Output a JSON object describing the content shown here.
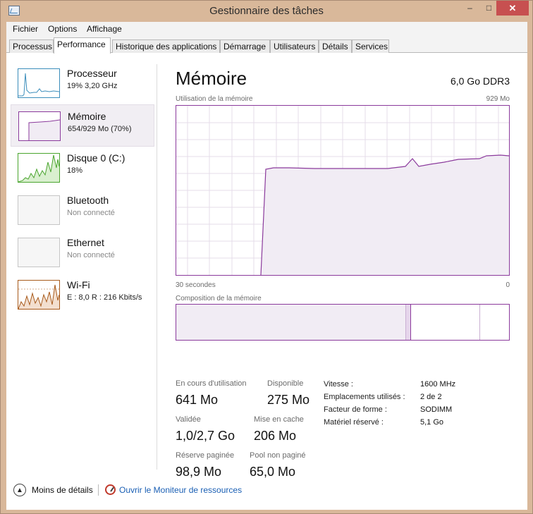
{
  "window": {
    "title": "Gestionnaire des tâches",
    "min": "–",
    "max": "□",
    "close": "✕"
  },
  "menu": {
    "file": "Fichier",
    "options": "Options",
    "view": "Affichage"
  },
  "tabs": [
    "Processus",
    "Performance",
    "Historique des applications",
    "Démarrage",
    "Utilisateurs",
    "Détails",
    "Services"
  ],
  "resources": [
    {
      "name": "Processeur",
      "detail": "19% 3,20 GHz"
    },
    {
      "name": "Mémoire",
      "detail": "654/929 Mo (70%)"
    },
    {
      "name": "Disque 0 (C:)",
      "detail": "18%"
    },
    {
      "name": "Bluetooth",
      "detail": "Non connecté"
    },
    {
      "name": "Ethernet",
      "detail": "Non connecté"
    },
    {
      "name": "Wi-Fi",
      "detail": "E : 8,0 R : 216 Kbits/s"
    }
  ],
  "memory": {
    "title": "Mémoire",
    "spec": "6,0 Go DDR3",
    "usage_label": "Utilisation de la mémoire",
    "usage_max": "929 Mo",
    "time_left": "30 secondes",
    "time_right": "0",
    "composition_label": "Composition de la mémoire",
    "in_use_fraction": 0.69,
    "modified_fraction": 0.014,
    "standby_fraction": 0.207,
    "stats": {
      "in_use_label": "En cours d'utilisation",
      "in_use": "641 Mo",
      "available_label": "Disponible",
      "available": "275 Mo",
      "committed_label": "Validée",
      "committed": "1,0/2,7 Go",
      "cached_label": "Mise en cache",
      "cached": "206 Mo",
      "paged_label": "Réserve paginée",
      "paged": "98,9 Mo",
      "nonpaged_label": "Pool non paginé",
      "nonpaged": "65,0 Mo"
    },
    "info": {
      "speed_label": "Vitesse :",
      "speed": "1600 MHz",
      "slots_label": "Emplacements utilisés :",
      "slots": "2 de 2",
      "form_label": "Facteur de forme :",
      "form": "SODIMM",
      "reserved_label": "Matériel réservé :",
      "reserved": "5,1 Go"
    }
  },
  "footer": {
    "less": "Moins de détails",
    "monitor": "Ouvrir le Moniteur de ressources"
  },
  "colors": {
    "memory": "#8b3a9c",
    "memory_fill": "#f1ecf4",
    "cpu": "#3b8dbb",
    "disk": "#4aa52e",
    "wifi": "#a85a1b"
  }
}
